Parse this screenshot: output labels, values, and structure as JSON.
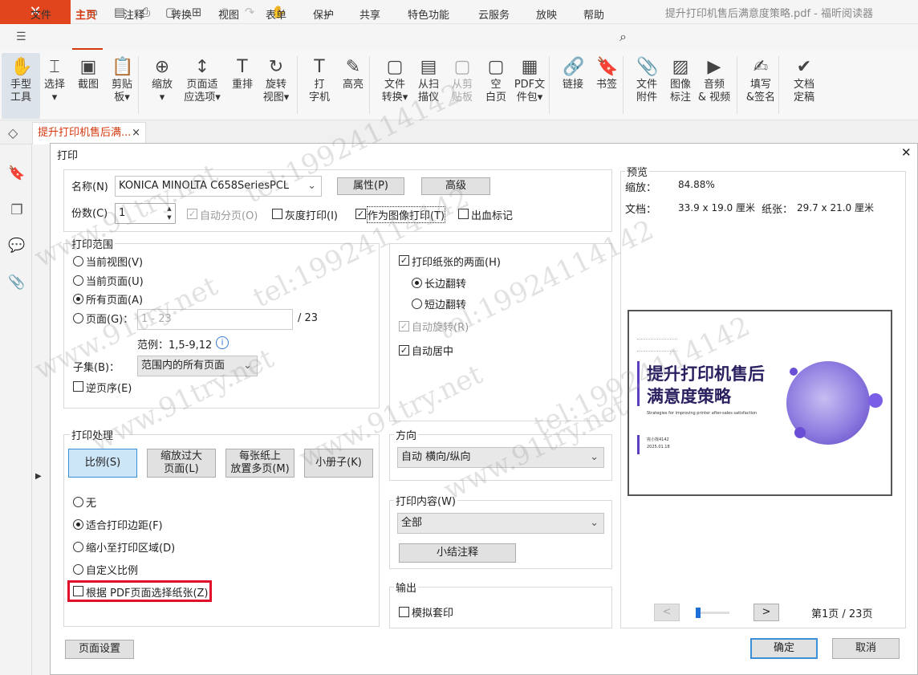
{
  "app": {
    "title": "提升打印机售后满意度策略.pdf - 福昕阅读器",
    "logo_text": "✕"
  },
  "menu": [
    "文件",
    "主页",
    "注释",
    "转换",
    "视图",
    "表单",
    "保护",
    "共享",
    "特色功能",
    "云服务",
    "放映",
    "帮助"
  ],
  "ribbon": [
    {
      "label": "手型\n工具",
      "icon": "✋"
    },
    {
      "label": "选择\n▾",
      "icon": "⌶"
    },
    {
      "label": "截图",
      "icon": "▣"
    },
    {
      "label": "剪贴\n板▾",
      "icon": "📋"
    },
    {
      "label": "缩放\n▾",
      "icon": "⊕"
    },
    {
      "label": "页面适\n应选项▾",
      "icon": "↕"
    },
    {
      "label": "重排",
      "icon": "T"
    },
    {
      "label": "旋转\n视图▾",
      "icon": "↻"
    },
    {
      "label": "打\n字机",
      "icon": "T"
    },
    {
      "label": "高亮",
      "icon": "✎"
    },
    {
      "label": "文件\n转换▾",
      "icon": "▢"
    },
    {
      "label": "从扫\n描仪",
      "icon": "▤"
    },
    {
      "label": "从剪\n贴板",
      "icon": "▢"
    },
    {
      "label": "空\n白页",
      "icon": "▢"
    },
    {
      "label": "PDF文\n件包▾",
      "icon": "▦"
    },
    {
      "label": "链接",
      "icon": "🔗"
    },
    {
      "label": "书签",
      "icon": "🔖"
    },
    {
      "label": "文件\n附件",
      "icon": "📎"
    },
    {
      "label": "图像\n标注",
      "icon": "▨"
    },
    {
      "label": "音频\n& 视频",
      "icon": "▶"
    },
    {
      "label": "填写\n&签名",
      "icon": "✍"
    },
    {
      "label": "文档\n定稿",
      "icon": "✔"
    }
  ],
  "tab": {
    "label": "提升打印机售后满...",
    "close": "×"
  },
  "dialog": {
    "title": "打印",
    "close": "✕",
    "printer_label": "名称(N)",
    "printer_value": "KONICA MINOLTA C658SeriesPCL",
    "properties_button": "属性(P)",
    "advanced_button": "高级",
    "copies_label": "份数(C)",
    "copies_value": "1",
    "collate_label": "自动分页(O)",
    "grayscale_label": "灰度打印(I)",
    "as_image_label": "作为图像打印(T)",
    "bleed_label": "出血标记",
    "range": {
      "title": "打印范围",
      "current_view": "当前视图(V)",
      "current_page": "当前页面(U)",
      "all_pages": "所有页面(A)",
      "pages": "页面(G)：",
      "pages_placeholder": "1 - 23",
      "pages_total": "/ 23",
      "example": "范例：1,5-9,12",
      "subset_label": "子集(B)：",
      "subset_value": "范围内的所有页面",
      "reverse": "逆页序(E)"
    },
    "duplex": {
      "both_sides": "打印纸张的两面(H)",
      "long_edge": "长边翻转",
      "short_edge": "短边翻转",
      "auto_rotate": "自动旋转(R)",
      "auto_center": "自动居中"
    },
    "handling": {
      "title": "打印处理",
      "scale": "比例(S)",
      "fit_large": "缩放过大\n页面(L)",
      "multiple": "每张纸上\n放置多页(M)",
      "booklet": "小册子(K)",
      "none": "无",
      "fit_margins": "适合打印边距(F)",
      "shrink": "缩小至打印区域(D)",
      "custom": "自定义比例",
      "choose_paper": "根据 PDF页面选择纸张(Z)"
    },
    "orientation": {
      "title": "方向",
      "value": "自动 横向/纵向"
    },
    "content": {
      "title": "打印内容(W)",
      "value": "全部",
      "summary_button": "小结注释"
    },
    "output": {
      "title": "输出",
      "simulate": "模拟套印"
    },
    "preview": {
      "title": "预览",
      "zoom_label": "缩放：",
      "zoom_value": "84.88%",
      "doc_label": "文档：",
      "doc_value": "33.9 x 19.0 厘米",
      "paper_label": "纸张：",
      "paper_value": "29.7 x 21.0 厘米",
      "slide_title": "提升打印机售后\n满意度策略",
      "slide_subtitle": "Strategies for improving printer after-sales satisfaction",
      "slide_author": "完小找4142",
      "slide_date": "2025.01.18",
      "page_indicator": "第1页 / 23页",
      "page_progress": 0.0,
      "prev": "<",
      "next": ">"
    },
    "page_setup_button": "页面设置",
    "ok_button": "确定",
    "cancel_button": "取消"
  },
  "watermark": {
    "site": "www.91try.net",
    "tel": "tel:19924114142"
  }
}
